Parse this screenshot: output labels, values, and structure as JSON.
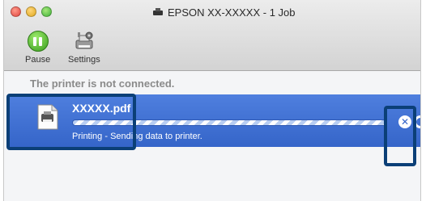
{
  "window": {
    "title": "EPSON XX-XXXXX - 1 Job"
  },
  "toolbar": {
    "pause_label": "Pause",
    "settings_label": "Settings"
  },
  "status": {
    "message": "The printer is not connected."
  },
  "job": {
    "file_name": "XXXXX.pdf",
    "status_text": "Printing - Sending data to printer.",
    "progress_fraction": 1.0
  },
  "colors": {
    "selection": "#3a6bd0",
    "callout_border": "#0b3f77",
    "pause_green": "#4cb52a"
  },
  "icons": {
    "close": "close-window-icon",
    "minimize": "minimize-window-icon",
    "zoom": "zoom-window-icon",
    "printer": "printer-icon",
    "pause": "pause-icon",
    "settings": "settings-icon",
    "file": "document-icon",
    "delete": "delete-job-icon"
  }
}
